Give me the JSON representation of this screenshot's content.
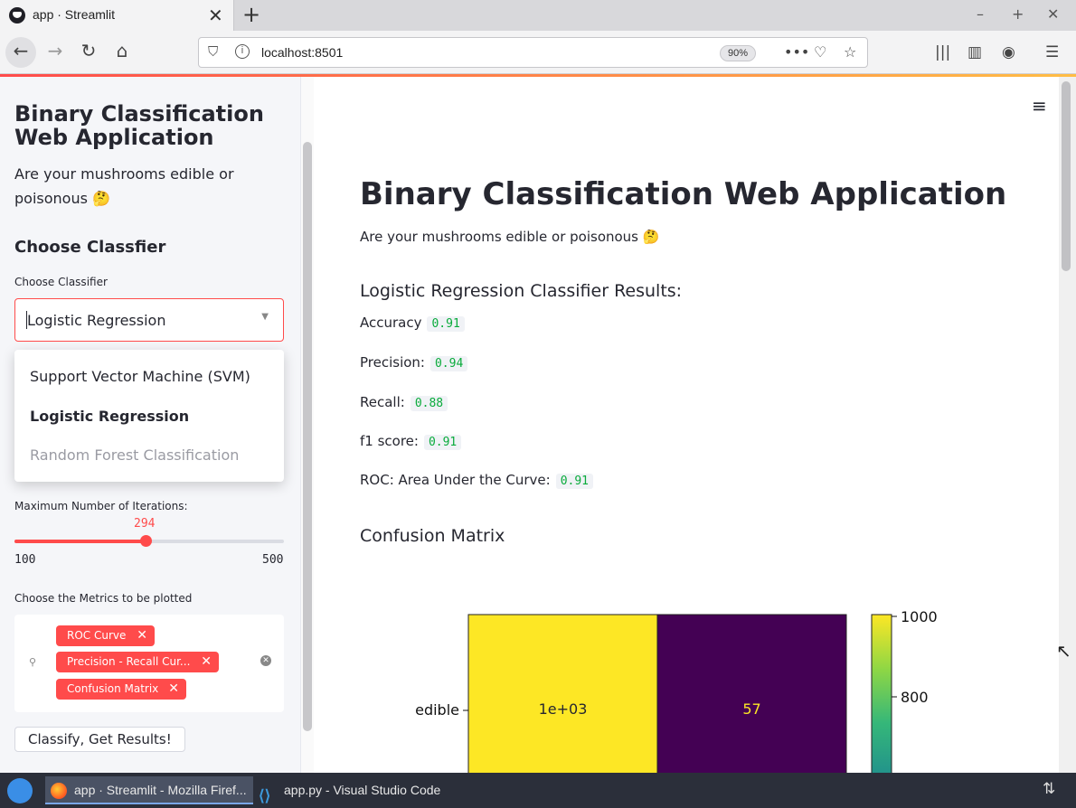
{
  "browser": {
    "tab_title": "app · Streamlit",
    "tab_close": "✕",
    "new_tab": "+",
    "url": "localhost:8501",
    "zoom": "90%",
    "window_controls": [
      "–",
      "+",
      "✕"
    ]
  },
  "sidebar": {
    "title": "Binary Classification Web Application",
    "subtitle": "Are your mushrooms edible or poisonous 🤔",
    "section_heading": "Choose Classfier",
    "classifier_label": "Choose Classifier",
    "classifier_value": "Logistic Regression",
    "classifier_options": [
      "Support Vector Machine (SVM)",
      "Logistic Regression",
      "Random Forest Classification"
    ],
    "iterations_label": "Maximum Number of Iterations:",
    "iterations_value": "294",
    "iterations_min": "100",
    "iterations_max": "500",
    "iterations_fraction": 0.485,
    "metrics_label": "Choose the Metrics to be plotted",
    "metrics_selected": [
      "ROC Curve",
      "Precision - Recall Cur...",
      "Confusion Matrix"
    ],
    "classify_button": "Classify, Get Results!"
  },
  "main": {
    "menu_icon": "≡",
    "title": "Binary Classification Web Application",
    "subtitle": "Are your mushrooms edible or poisonous 🤔",
    "results_heading": "Logistic Regression Classifier Results:",
    "metrics": [
      {
        "label": "Accuracy",
        "value": "0.91"
      },
      {
        "label": "Precision:",
        "value": "0.94"
      },
      {
        "label": "Recall:",
        "value": "0.88"
      },
      {
        "label": "f1 score:",
        "value": "0.91"
      },
      {
        "label": "ROC: Area Under the Curve:",
        "value": "0.91"
      }
    ],
    "cm_heading": "Confusion Matrix"
  },
  "chart_data": {
    "type": "heatmap",
    "row_labels": [
      "edible"
    ],
    "cells": [
      {
        "row": "edible",
        "col": 0,
        "value": 1000,
        "label": "1e+03",
        "color": "#fde725",
        "text_color": "#262730"
      },
      {
        "row": "edible",
        "col": 1,
        "value": 57,
        "label": "57",
        "color": "#440154",
        "text_color": "#fde725"
      }
    ],
    "colorbar_ticks": [
      "1000",
      "800"
    ],
    "colormap": "viridis"
  },
  "taskbar": {
    "items": [
      "app · Streamlit - Mozilla Firef...",
      "app.py - Visual Studio Code"
    ]
  },
  "colors": {
    "accent": "#ff4b4b",
    "code_green": "#09ab3b",
    "sidebar_bg": "#f5f6f9"
  }
}
